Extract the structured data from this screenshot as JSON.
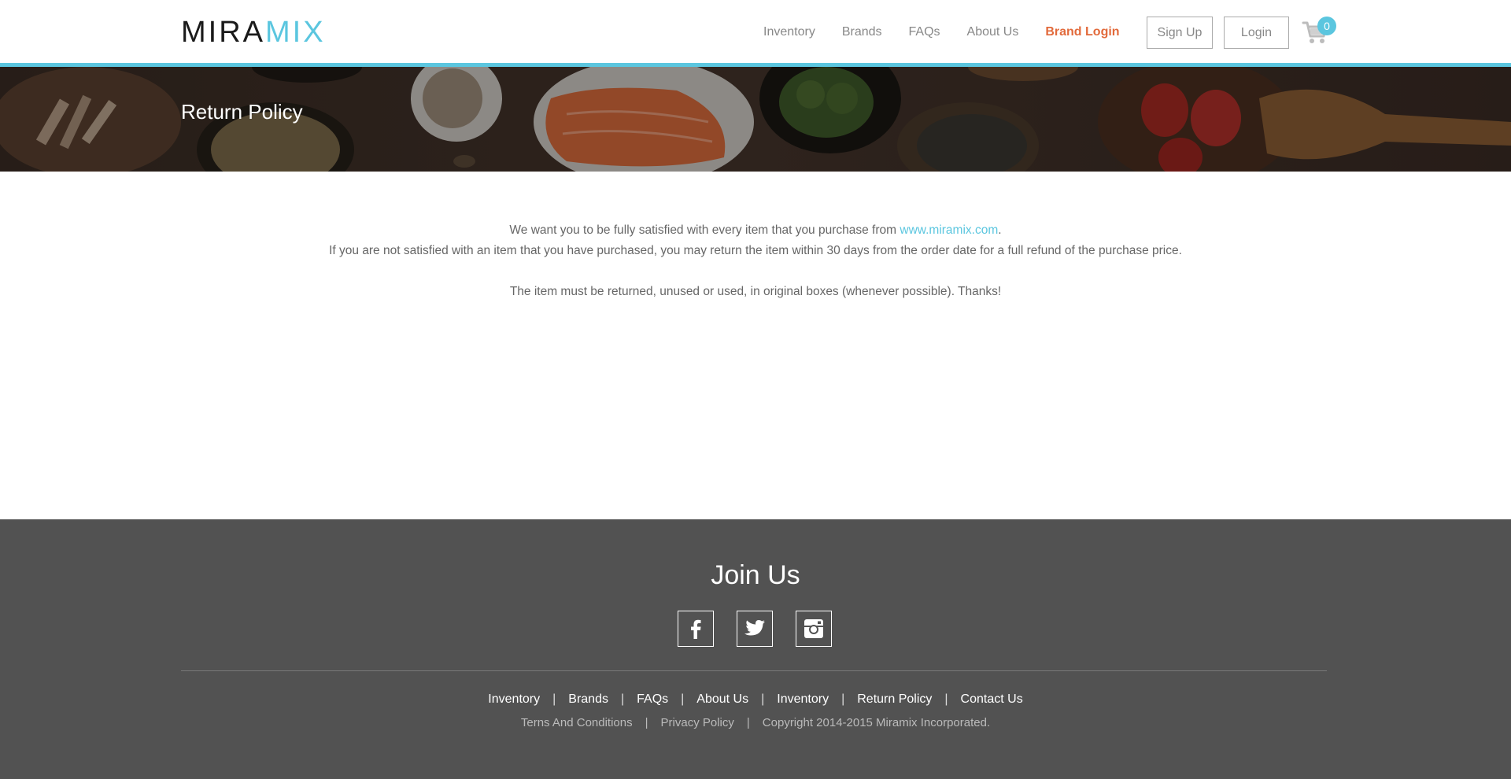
{
  "brand": {
    "logo_part1": "MIRA",
    "logo_part2": "MIX",
    "accent_color": "#5bc6df",
    "highlight_color": "#e26a3b"
  },
  "nav": {
    "items": [
      {
        "label": "Inventory"
      },
      {
        "label": "Brands"
      },
      {
        "label": "FAQs"
      },
      {
        "label": "About Us"
      },
      {
        "label": "Brand Login"
      }
    ],
    "signup_label": "Sign Up",
    "login_label": "Login",
    "cart_count": "0"
  },
  "hero": {
    "title": "Return Policy"
  },
  "content": {
    "p1_text": "We want you to be fully satisfied with every item that you purchase from ",
    "p1_link": "www.miramix.com",
    "p1_end": ".",
    "p2": "If you are not satisfied with an item that you have purchased, you may return the item within 30 days from the order date for a full refund of the purchase price.",
    "p3": "The item must be returned, unused or used, in original boxes (whenever possible). Thanks!"
  },
  "footer": {
    "join_title": "Join Us",
    "social": [
      "facebook-icon",
      "twitter-icon",
      "instagram-icon"
    ],
    "links": [
      {
        "label": "Inventory"
      },
      {
        "label": "Brands"
      },
      {
        "label": "FAQs"
      },
      {
        "label": "About Us"
      },
      {
        "label": "Inventory"
      },
      {
        "label": "Return Policy"
      },
      {
        "label": "Contact Us"
      }
    ],
    "legal": {
      "terms": "Terns And Conditions",
      "privacy": "Privacy Policy",
      "copyright": "Copyright 2014-2015 Miramix Incorporated."
    },
    "separator": "|"
  }
}
